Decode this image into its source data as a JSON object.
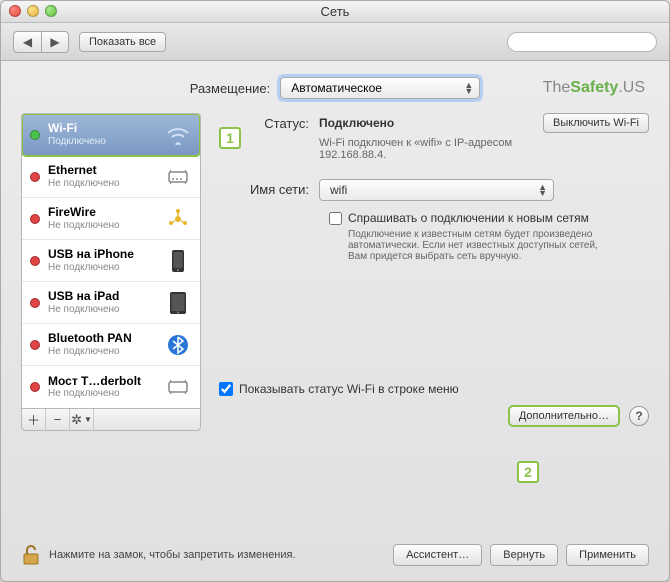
{
  "window": {
    "title": "Сеть"
  },
  "toolbar": {
    "show_all": "Показать все"
  },
  "location": {
    "label": "Размещение:",
    "value": "Автоматическое"
  },
  "brand": {
    "the": "The",
    "safety": "Safety",
    "us": ".US"
  },
  "services": [
    {
      "name": "Wi-Fi",
      "status": "Подключено",
      "dot": "green",
      "selected": true,
      "icon": "wifi-icon"
    },
    {
      "name": "Ethernet",
      "status": "Не подключено",
      "dot": "red",
      "selected": false,
      "icon": "ethernet-icon"
    },
    {
      "name": "FireWire",
      "status": "Не подключено",
      "dot": "red",
      "selected": false,
      "icon": "firewire-icon"
    },
    {
      "name": "USB на iPhone",
      "status": "Не подключено",
      "dot": "red",
      "selected": false,
      "icon": "iphone-icon"
    },
    {
      "name": "USB на iPad",
      "status": "Не подключено",
      "dot": "red",
      "selected": false,
      "icon": "ipad-icon"
    },
    {
      "name": "Bluetooth PAN",
      "status": "Не подключено",
      "dot": "red",
      "selected": false,
      "icon": "bluetooth-icon"
    },
    {
      "name": "Мост T…derbolt",
      "status": "Не подключено",
      "dot": "red",
      "selected": false,
      "icon": "thunderbolt-icon"
    }
  ],
  "detail": {
    "status_label": "Статус:",
    "status_value": "Подключено",
    "toggle_button": "Выключить Wi-Fi",
    "status_desc": "Wi-Fi подключен к «wifi» с IP-адресом 192.168.88.4.",
    "network_label": "Имя сети:",
    "network_value": "wifi",
    "ask_join_label": "Спрашивать о подключении к новым сетям",
    "ask_join_desc": "Подключение к известным сетям будет произведено автоматически. Если нет известных доступных сетей, Вам придется выбрать сеть вручную.",
    "show_menubar": "Показывать статус Wi-Fi в строке меню",
    "advanced_button": "Дополнительно…"
  },
  "lock": {
    "text": "Нажмите на замок, чтобы запретить изменения."
  },
  "footer": {
    "assistant": "Ассистент…",
    "revert": "Вернуть",
    "apply": "Применить"
  },
  "callouts": {
    "one": "1",
    "two": "2"
  }
}
